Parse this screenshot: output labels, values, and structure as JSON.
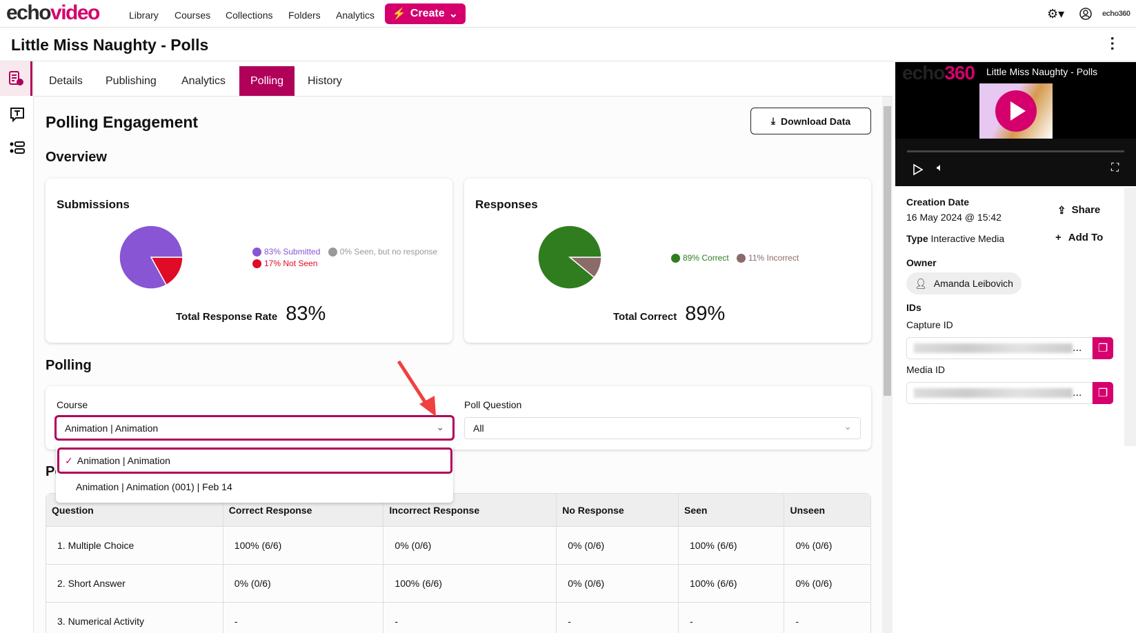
{
  "brand": {
    "logo_part1": "echo",
    "logo_part2": "video",
    "corner_logo": "echo360",
    "accent": "#d5006d",
    "tab_active": "#b0005a"
  },
  "nav": {
    "items": [
      "Library",
      "Courses",
      "Collections",
      "Folders",
      "Analytics"
    ],
    "create": "Create"
  },
  "page": {
    "title": "Little Miss Naughty - Polls"
  },
  "tabs": [
    "Details",
    "Publishing",
    "Analytics",
    "Polling",
    "History"
  ],
  "main": {
    "heading": "Polling Engagement",
    "download": "Download Data",
    "overview": "Overview",
    "submissions": {
      "title": "Submissions",
      "legend": [
        "83% Submitted",
        "0% Seen, but no response",
        "17% Not Seen"
      ],
      "total_label": "Total Response Rate",
      "total_value": "83%"
    },
    "responses": {
      "title": "Responses",
      "legend": [
        "89% Correct",
        "11% Incorrect"
      ],
      "total_label": "Total Correct",
      "total_value": "89%"
    },
    "polling": "Polling",
    "course_label": "Course",
    "course_value": "Animation | Animation",
    "poll_label": "Poll Question",
    "poll_value": "All",
    "course_options": [
      "Animation | Animation",
      "Animation | Animation (001) | Feb 14"
    ],
    "table_heading_partial": "Po",
    "table": {
      "headers": [
        "Question",
        "Correct Response",
        "Incorrect Response",
        "No Response",
        "Seen",
        "Unseen"
      ],
      "rows": [
        [
          "1. Multiple Choice",
          "100% (6/6)",
          "0% (0/6)",
          "0% (0/6)",
          "100% (6/6)",
          "0% (0/6)"
        ],
        [
          "2. Short Answer",
          "0% (0/6)",
          "100% (6/6)",
          "0% (0/6)",
          "100% (6/6)",
          "0% (0/6)"
        ],
        [
          "3. Numerical Activity",
          "-",
          "-",
          "-",
          "-",
          "-"
        ]
      ]
    }
  },
  "chart_data": [
    {
      "type": "pie",
      "title": "Submissions",
      "slices": [
        {
          "label": "Submitted",
          "value": 83,
          "color": "#8855d4"
        },
        {
          "label": "Seen, but no response",
          "value": 0,
          "color": "#999999"
        },
        {
          "label": "Not Seen",
          "value": 17,
          "color": "#e00b25"
        }
      ]
    },
    {
      "type": "pie",
      "title": "Responses",
      "slices": [
        {
          "label": "Correct",
          "value": 89,
          "color": "#2f7d1f"
        },
        {
          "label": "Incorrect",
          "value": 11,
          "color": "#8b6a6a"
        }
      ]
    }
  ],
  "player": {
    "logo": "echo360",
    "title": "Little Miss Naughty - Polls"
  },
  "details": {
    "creation_label": "Creation Date",
    "creation_value": "16 May 2024 @ 15:42",
    "type_label": "Type",
    "type_value": "Interactive Media",
    "share": "Share",
    "add_to": "Add To",
    "owner_label": "Owner",
    "owner": "Amanda Leibovich",
    "ids_label": "IDs",
    "capture_label": "Capture ID",
    "media_label": "Media ID",
    "ellipsis": "..."
  }
}
